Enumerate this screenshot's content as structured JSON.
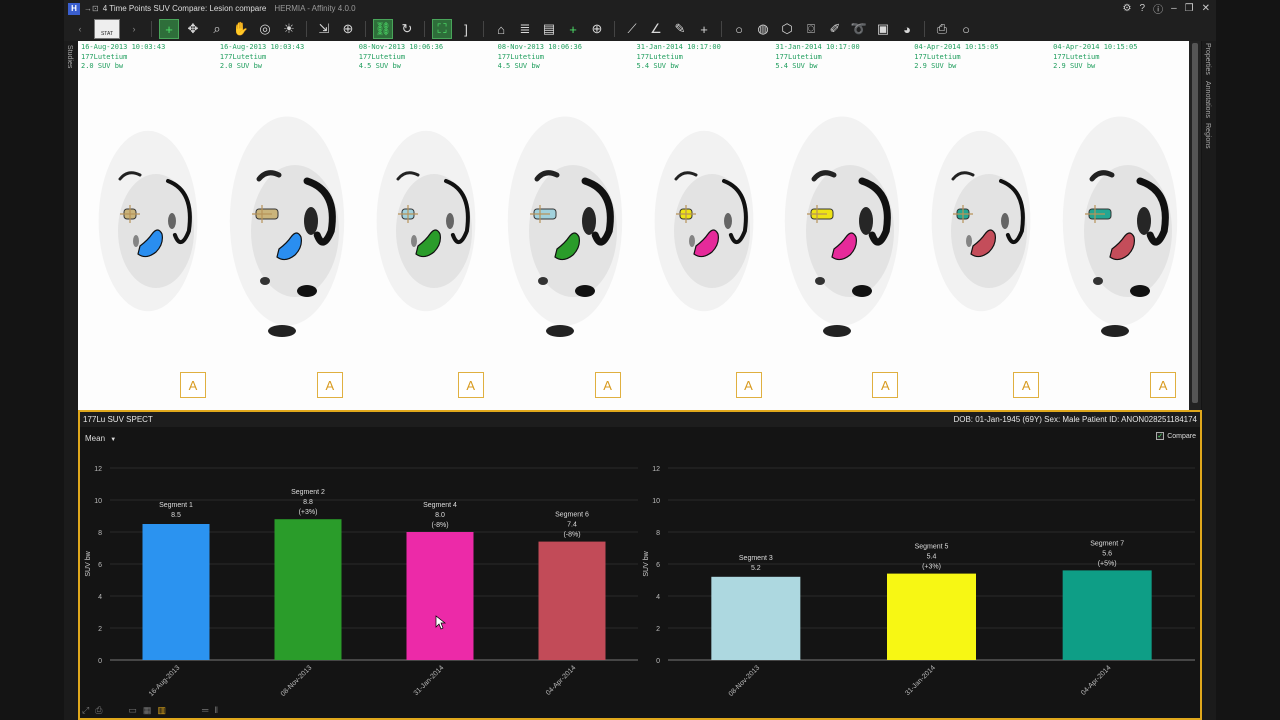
{
  "titlebar": {
    "logo": "H",
    "title": "4 Time Points SUV Compare: Lesion compare",
    "subtitle": "HERMIA - Affinity 4.0.0",
    "win_buttons": [
      "⚙",
      "?",
      "ⓘ",
      "–",
      "❐",
      "✕"
    ]
  },
  "toolbar": {
    "stat_label": "STAT",
    "icons": [
      "crosshair-icon",
      "pan-tool-icon",
      "zoom-icon",
      "hand-icon",
      "target-icon",
      "brightness-icon",
      "cursor-icon",
      "move-icon",
      "link-icon",
      "rotate-icon",
      "fit-icon",
      "bracket-icon",
      "tag-icon",
      "list-icon",
      "clipboard-icon",
      "plus-icon",
      "globe-icon",
      "ruler-icon",
      "angle-icon",
      "pencil-icon",
      "cross-icon",
      "circle-icon",
      "sphere-icon",
      "cube-icon",
      "cylinder-icon",
      "brush-icon",
      "lasso-icon",
      "histogram-icon",
      "fill-icon",
      "camera-icon",
      "dot-icon"
    ]
  },
  "left_strip": {
    "label": "Studies"
  },
  "right_strip": {
    "labels": [
      "Properties",
      "Annotations",
      "Regions"
    ]
  },
  "timepoints": [
    {
      "date": "16-Aug-2013 10:03:43",
      "isotope": "177Lutetium",
      "suv": "2.0  SUV bw",
      "anchor": "A",
      "lesion_color": "#2a8ef0",
      "marker": "#c8b070"
    },
    {
      "date": "16-Aug-2013 10:03:43",
      "isotope": "177Lutetium",
      "suv": "2.0  SUV bw",
      "anchor": "A",
      "lesion_color": "#2a8ef0",
      "marker": "#c8b070"
    },
    {
      "date": "08-Nov-2013 10:06:36",
      "isotope": "177Lutetium",
      "suv": "4.5  SUV bw",
      "anchor": "A",
      "lesion_color": "#2a9c2a",
      "marker": "#9ad0dc"
    },
    {
      "date": "08-Nov-2013 10:06:36",
      "isotope": "177Lutetium",
      "suv": "4.5  SUV bw",
      "anchor": "A",
      "lesion_color": "#2a9c2a",
      "marker": "#9ad0dc"
    },
    {
      "date": "31-Jan-2014 10:17:00",
      "isotope": "177Lutetium",
      "suv": "5.4  SUV bw",
      "anchor": "A",
      "lesion_color": "#e62a9a",
      "marker": "#f0e400"
    },
    {
      "date": "31-Jan-2014 10:17:00",
      "isotope": "177Lutetium",
      "suv": "5.4  SUV bw",
      "anchor": "A",
      "lesion_color": "#e62a9a",
      "marker": "#f0e400"
    },
    {
      "date": "04-Apr-2014 10:15:05",
      "isotope": "177Lutetium",
      "suv": "2.9  SUV bw",
      "anchor": "A",
      "lesion_color": "#c44d5a",
      "marker": "#10a08a"
    },
    {
      "date": "04-Apr-2014 10:15:05",
      "isotope": "177Lutetium",
      "suv": "2.9  SUV bw",
      "anchor": "A",
      "lesion_color": "#c44d5a",
      "marker": "#10a08a"
    }
  ],
  "panel": {
    "title": "177Lu SUV SPECT",
    "patient_info": "DOB: 01-Jan-1945  (69Y)   Sex: Male   Patient ID: ANON028251184174",
    "mean_label": "Mean",
    "compare_label": "Compare",
    "compare_checked": true
  },
  "chart_data": [
    {
      "type": "bar",
      "ylabel": "SUV bw",
      "ylim": [
        0,
        12
      ],
      "yticks": [
        0,
        2,
        4,
        6,
        8,
        10,
        12
      ],
      "categories": [
        "16-Aug-2013",
        "08-Nov-2013",
        "31-Jan-2014",
        "04-Apr-2014"
      ],
      "bars": [
        {
          "label": "Segment 1",
          "value": 8.5,
          "value_text": "8.5",
          "change": "",
          "color": "#2b93f0"
        },
        {
          "label": "Segment 2",
          "value": 8.8,
          "value_text": "8.8",
          "change": "(+3%)",
          "color": "#2a9c2a"
        },
        {
          "label": "Segment 4",
          "value": 8.0,
          "value_text": "8.0",
          "change": "(-8%)",
          "color": "#ec2aa8"
        },
        {
          "label": "Segment 6",
          "value": 7.4,
          "value_text": "7.4",
          "change": "(-8%)",
          "color": "#c24b58"
        }
      ]
    },
    {
      "type": "bar",
      "ylabel": "SUV bw",
      "ylim": [
        0,
        12
      ],
      "yticks": [
        0,
        2,
        4,
        6,
        8,
        10,
        12
      ],
      "categories": [
        "08-Nov-2013",
        "31-Jan-2014",
        "04-Apr-2014"
      ],
      "bars": [
        {
          "label": "Segment 3",
          "value": 5.2,
          "value_text": "5.2",
          "change": "",
          "color": "#add8e0"
        },
        {
          "label": "Segment 5",
          "value": 5.4,
          "value_text": "5.4",
          "change": "(+3%)",
          "color": "#f7f714"
        },
        {
          "label": "Segment 7",
          "value": 5.6,
          "value_text": "5.6",
          "change": "(+5%)",
          "color": "#0e9e86"
        }
      ]
    }
  ]
}
